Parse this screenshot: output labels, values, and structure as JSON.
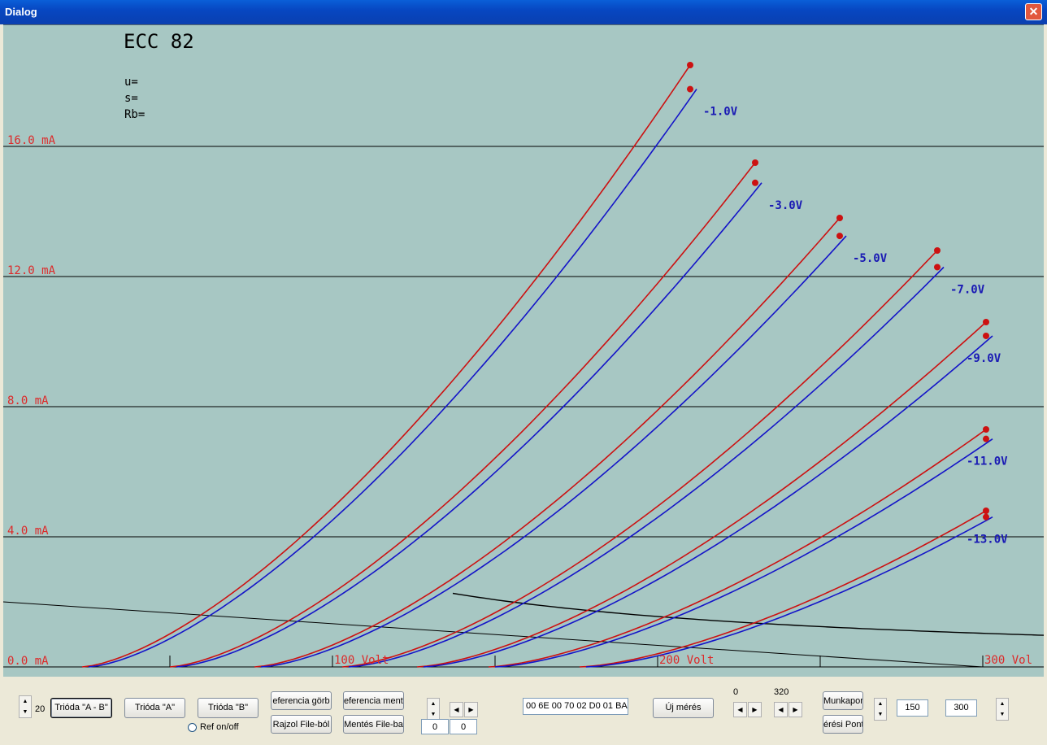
{
  "window": {
    "title": "Dialog",
    "close_glyph": "✕"
  },
  "plot": {
    "tube_name": "ECC 82",
    "params": {
      "u": "u=",
      "s": "s=",
      "rb": "Rb="
    },
    "colors": {
      "background": "#a7c7c3",
      "reference": "#cc1111",
      "measured": "#1414c8",
      "grid": "#000000",
      "current_label": "#dd2a2a",
      "voltage_label": "#dd2a2a",
      "grid_label": "#1a1ab4"
    },
    "current_labels": [
      {
        "value": 16,
        "text": "16.0 mA"
      },
      {
        "value": 12,
        "text": "12.0 mA"
      },
      {
        "value": 8,
        "text": "8.0 mA"
      },
      {
        "value": 4,
        "text": "4.0 mA"
      },
      {
        "value": 0,
        "text": "0.0 mA"
      }
    ],
    "voltage_labels": [
      {
        "value": 100,
        "text": "100 Volt"
      },
      {
        "value": 200,
        "text": "200 Volt"
      },
      {
        "value": 300,
        "text": "300 Vol"
      }
    ]
  },
  "chart_data": {
    "type": "line",
    "xlabel": "",
    "ylabel": "",
    "xlim": [
      0,
      320
    ],
    "ylim": [
      0,
      20
    ],
    "x_unit": "Volt",
    "y_unit": "mA",
    "series": [
      {
        "name": "-1.0V",
        "x_start": 25,
        "x_end": 212,
        "i_end": 18.5
      },
      {
        "name": "-3.0V",
        "x_start": 52,
        "x_end": 232,
        "i_end": 15.5
      },
      {
        "name": "-5.0V",
        "x_start": 78,
        "x_end": 258,
        "i_end": 13.8
      },
      {
        "name": "-7.0V",
        "x_start": 105,
        "x_end": 288,
        "i_end": 12.8
      },
      {
        "name": "-9.0V",
        "x_start": 128,
        "x_end": 303,
        "i_end": 10.6
      },
      {
        "name": "-11.0V",
        "x_start": 150,
        "x_end": 303,
        "i_end": 7.3
      },
      {
        "name": "-13.0V",
        "x_start": 178,
        "x_end": 303,
        "i_end": 4.8
      }
    ]
  },
  "controls": {
    "spin_value": "20",
    "btn_trioda_ab": "Trióda \"A - B\"",
    "btn_trioda_a": "Trióda  \"A\"",
    "btn_trioda_b": "Trióda  \"B\"",
    "ref_toggle_label": "Ref on/off",
    "btn_ref_gorbe": "eferencia görb",
    "btn_rajzol": "Rajzol File-ból",
    "btn_ref_mentes": "eferencia mentő",
    "btn_mentes": "Mentés File-ba",
    "field_a": "0",
    "field_b": "0",
    "hex_data": "00 6E 00 70 02 D0 01 BA",
    "btn_uj_meres": "Új mérés",
    "range_min_label": "0",
    "range_max_label": "320",
    "btn_munkapont": "Munkapon",
    "btn_meresi_pont": "érési Pont",
    "field_c": "150",
    "field_d": "300",
    "spin_up": "▲",
    "spin_down": "▼",
    "arrow_left": "◀",
    "arrow_right": "▶"
  }
}
